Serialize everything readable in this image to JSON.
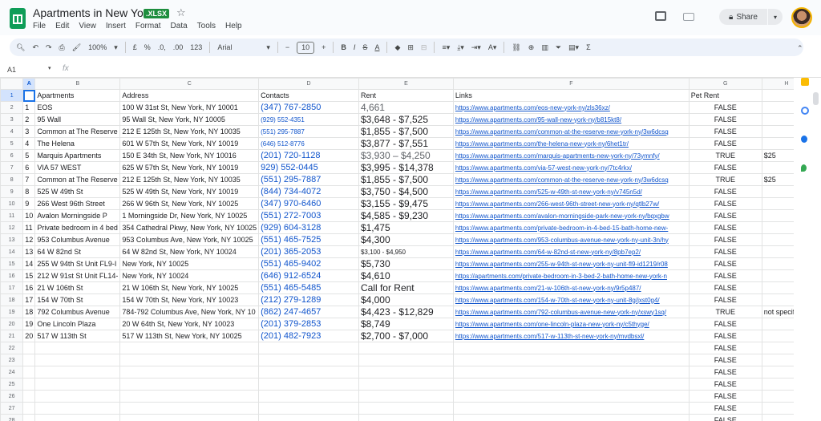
{
  "app": {
    "title": "Apartments in New York",
    "badge": ".XLSX",
    "menus": [
      "File",
      "Edit",
      "View",
      "Insert",
      "Format",
      "Data",
      "Tools",
      "Help"
    ],
    "share_label": "Share"
  },
  "toolbar": {
    "zoom": "100%",
    "currency": "£",
    "percent": "%",
    "dec_less": ".0,",
    "dec_more": ".00",
    "number_format": "123",
    "font": "Arial",
    "font_size": "10",
    "minus": "−",
    "plus": "+"
  },
  "formula_bar": {
    "cell_ref": "A1",
    "fx": "fx"
  },
  "columns": [
    "A",
    "B",
    "C",
    "D",
    "E",
    "F",
    "G",
    "H"
  ],
  "header_row": {
    "b": "Apartments",
    "c": "Address",
    "d": "Contacts",
    "e": "Rent",
    "f": "Links",
    "g": "Pet Rent"
  },
  "rows": [
    {
      "num": "2",
      "a": "1",
      "b": "EOS",
      "c": "100 W 31st St, New York, NY 10001",
      "d": "(347) 767-2850",
      "ds": "big",
      "e": "4,661",
      "es": "gray",
      "f": "https://www.apartments.com/eos-new-york-ny/zls36xz/",
      "g": "FALSE",
      "h": ""
    },
    {
      "num": "3",
      "a": "2",
      "b": "95 Wall",
      "c": "95 Wall St, New York, NY 10005",
      "d": "(929) 552-4351",
      "ds": "small",
      "e": "$3,648 - $7,525",
      "es": "big",
      "f": "https://www.apartments.com/95-wall-new-york-ny/b815kt8/",
      "g": "FALSE",
      "h": ""
    },
    {
      "num": "4",
      "a": "3",
      "b": "Common at The Reserve",
      "c": "212 E 125th St, New York, NY 10035",
      "d": "(551) 295-7887",
      "ds": "small",
      "e": "$1,855 - $7,500",
      "es": "big",
      "f": "https://www.apartments.com/common-at-the-reserve-new-york-ny/3w6dcsq",
      "g": "FALSE",
      "h": ""
    },
    {
      "num": "5",
      "a": "4",
      "b": "The Helena",
      "c": "601 W 57th St, New York, NY 10019",
      "d": "(646) 512-8776",
      "ds": "small",
      "e": "$3,877 - $7,551",
      "es": "big",
      "f": "https://www.apartments.com/the-helena-new-york-ny/6het1tr/",
      "g": "FALSE",
      "h": ""
    },
    {
      "num": "6",
      "a": "5",
      "b": "Marquis Apartments",
      "c": "150 E 34th St, New York, NY 10016",
      "d": "(201) 720-1128",
      "ds": "big",
      "e": "$3,930 – $4,250",
      "es": "gray",
      "f": "https://www.apartments.com/marquis-apartments-new-york-ny/73ymnfy/",
      "g": "TRUE",
      "h": "$25"
    },
    {
      "num": "7",
      "a": "6",
      "b": "VIA 57 WEST",
      "c": "625 W 57th St, New York, NY 10019",
      "d": "929) 552-0445",
      "ds": "big",
      "e": "$3,995 - $14,378",
      "es": "big",
      "f": "https://www.apartments.com/via-57-west-new-york-ny/7tc4rkx/",
      "g": "FALSE",
      "h": ""
    },
    {
      "num": "8",
      "a": "7",
      "b": "Common at The Reserve",
      "c": "212 E 125th St, New York, NY 10035",
      "d": "(551) 295-7887",
      "ds": "big",
      "e": "$1,855 - $7,500",
      "es": "big",
      "f": "https://www.apartments.com/common-at-the-reserve-new-york-ny/3w6dcsq",
      "g": "TRUE",
      "h": "$25"
    },
    {
      "num": "9",
      "a": "8",
      "b": "525 W 49th St",
      "c": "525 W 49th St, New York, NY 10019",
      "d": "(844) 734-4072",
      "ds": "big",
      "e": "$3,750 - $4,500",
      "es": "big",
      "f": "https://www.apartments.com/525-w-49th-st-new-york-ny/v745n5d/",
      "g": "FALSE",
      "h": ""
    },
    {
      "num": "10",
      "a": "9",
      "b": "266 West 96th Street",
      "c": "266 W 96th St, New York, NY 10025",
      "d": "(347) 970-6460",
      "ds": "big",
      "e": "$3,155 - $9,475",
      "es": "big",
      "f": "https://www.apartments.com/266-west-96th-street-new-york-ny/qtlb27w/",
      "g": "FALSE",
      "h": ""
    },
    {
      "num": "11",
      "a": "10",
      "b": "Avalon Morningside P",
      "c": "1 Morningside Dr, New York, NY 10025",
      "d": "(551) 272-7003",
      "ds": "big",
      "e": "$4,585 - $9,230",
      "es": "big",
      "f": "https://www.apartments.com/avalon-morningside-park-new-york-ny/bqxgbw",
      "g": "FALSE",
      "h": ""
    },
    {
      "num": "12",
      "a": "11",
      "b": "Private bedroom in 4 bed",
      "c": "354 Cathedral Pkwy, New York, NY 10025",
      "d": "(929) 604-3128",
      "ds": "big",
      "e": "$1,475",
      "es": "big",
      "f": "https://www.apartments.com/private-bedroom-in-4-bed-15-bath-home-new-",
      "g": "FALSE",
      "h": ""
    },
    {
      "num": "13",
      "a": "12",
      "b": "953 Columbus Avenue",
      "c": "953 Columbus Ave, New York, NY 10025",
      "d": "(551) 465-7525",
      "ds": "big",
      "e": "$4,300",
      "es": "big",
      "f": "https://www.apartments.com/953-columbus-avenue-new-york-ny-unit-3n/hy",
      "g": "FALSE",
      "h": ""
    },
    {
      "num": "14",
      "a": "13",
      "b": "64 W 82nd St",
      "c": "64 W 82nd St, New York, NY 10024",
      "d": "(201) 365-2053",
      "ds": "big",
      "e": "$3,100 - $4,950",
      "es": "small",
      "f": "https://www.apartments.com/64-w-82nd-st-new-york-ny/8pb7ep2/",
      "g": "FALSE",
      "h": ""
    },
    {
      "num": "15",
      "a": "14",
      "b": "255 W 94th St Unit FL9-I",
      "c": "New York, NY 10025",
      "d": "(551) 465-9402",
      "ds": "big",
      "e": "$5,730",
      "es": "big",
      "f": "https://www.apartments.com/255-w-94th-st-new-york-ny-unit-fl9-id1219/r08",
      "g": "FALSE",
      "h": ""
    },
    {
      "num": "16",
      "a": "15",
      "b": "212 W 91st St Unit FL14-",
      "c": "New York, NY 10024",
      "d": "(646) 912-6524",
      "ds": "big",
      "e": "$4,610",
      "es": "big",
      "f": "https://apartments.com/private-bedroom-in-3-bed-2-bath-home-new-york-n",
      "g": "FALSE",
      "h": ""
    },
    {
      "num": "17",
      "a": "16",
      "b": "21 W 106th St",
      "c": "21 W 106th St, New York, NY 10025",
      "d": "(551) 465-5485",
      "ds": "big",
      "e": "Call for Rent",
      "es": "big",
      "f": "https://www.apartments.com/21-w-106th-st-new-york-ny/9r5p487/",
      "g": "FALSE",
      "h": ""
    },
    {
      "num": "18",
      "a": "17",
      "b": "154 W 70th St",
      "c": "154 W 70th St, New York, NY 10023",
      "d": "(212) 279-1289",
      "ds": "big",
      "e": "$4,000",
      "es": "big",
      "f": "https://www.apartments.com/154-w-70th-st-new-york-ny-unit-8g/jxst0g4/",
      "g": "FALSE",
      "h": ""
    },
    {
      "num": "19",
      "a": "18",
      "b": "792 Columbus Avenue",
      "c": "784-792 Columbus Ave, New York, NY 10",
      "d": "(862) 247-4657",
      "ds": "big",
      "e": "$4,423 - $12,829",
      "es": "big",
      "f": "https://www.apartments.com/792-columbus-avenue-new-york-ny/xswy1sq/",
      "g": "TRUE",
      "h": "not specified"
    },
    {
      "num": "20",
      "a": "19",
      "b": "One Lincoln Plaza",
      "c": "20 W 64th St, New York, NY 10023",
      "d": "(201) 379-2853",
      "ds": "big",
      "e": "$8,749",
      "es": "big",
      "f": "https://www.apartments.com/one-lincoln-plaza-new-york-ny/c5thyge/",
      "g": "FALSE",
      "h": ""
    },
    {
      "num": "21",
      "a": "20",
      "b": "517 W 113th St",
      "c": "517 W 113th St, New York, NY 10025",
      "d": "(201) 482-7923",
      "ds": "big",
      "e": "$2,700 - $7,000",
      "es": "big",
      "f": "https://www.apartments.com/517-w-113th-st-new-york-ny/mvdbsxl/",
      "g": "FALSE",
      "h": ""
    },
    {
      "num": "22",
      "a": "",
      "b": "",
      "c": "",
      "d": "",
      "ds": "big",
      "e": "",
      "es": "big",
      "f": "",
      "g": "FALSE",
      "h": ""
    },
    {
      "num": "23",
      "a": "",
      "b": "",
      "c": "",
      "d": "",
      "ds": "big",
      "e": "",
      "es": "big",
      "f": "",
      "g": "FALSE",
      "h": ""
    },
    {
      "num": "24",
      "a": "",
      "b": "",
      "c": "",
      "d": "",
      "ds": "big",
      "e": "",
      "es": "big",
      "f": "",
      "g": "FALSE",
      "h": ""
    },
    {
      "num": "25",
      "a": "",
      "b": "",
      "c": "",
      "d": "",
      "ds": "big",
      "e": "",
      "es": "big",
      "f": "",
      "g": "FALSE",
      "h": ""
    },
    {
      "num": "26",
      "a": "",
      "b": "",
      "c": "",
      "d": "",
      "ds": "big",
      "e": "",
      "es": "big",
      "f": "",
      "g": "FALSE",
      "h": ""
    },
    {
      "num": "27",
      "a": "",
      "b": "",
      "c": "",
      "d": "",
      "ds": "big",
      "e": "",
      "es": "big",
      "f": "",
      "g": "FALSE",
      "h": ""
    },
    {
      "num": "28",
      "a": "",
      "b": "",
      "c": "",
      "d": "",
      "ds": "big",
      "e": "",
      "es": "big",
      "f": "",
      "g": "FALSE",
      "h": ""
    }
  ]
}
